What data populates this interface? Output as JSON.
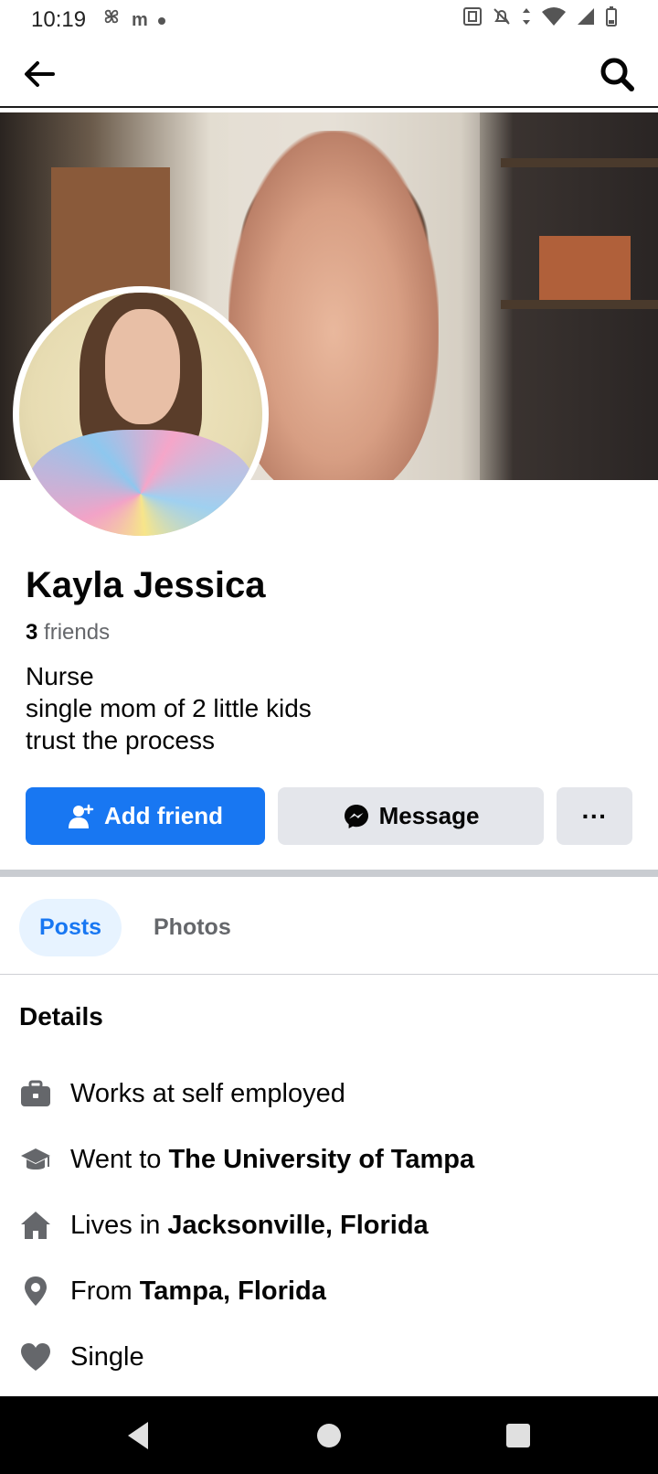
{
  "status_bar": {
    "time": "10:19",
    "left_icons": [
      "pinwheel-icon",
      "m-zone-icon",
      "dot-icon"
    ],
    "right_icons": [
      "nfc-icon",
      "bell-off-icon",
      "data-arrows-icon",
      "wifi-icon",
      "signal-icon",
      "battery-icon"
    ]
  },
  "header": {
    "back_icon": "arrow-left-icon",
    "search_icon": "search-icon"
  },
  "profile": {
    "name": "Kayla Jessica",
    "friends_count": "3",
    "friends_label": "friends",
    "bio": [
      "Nurse",
      "single mom of 2 little kids",
      "trust the process"
    ]
  },
  "actions": {
    "add_friend": "Add friend",
    "message": "Message",
    "more": "···"
  },
  "tabs": [
    {
      "label": "Posts",
      "selected": true
    },
    {
      "label": "Photos",
      "selected": false
    }
  ],
  "details": {
    "title": "Details",
    "items": [
      {
        "icon": "briefcase-icon",
        "prefix": "Works at self employed",
        "bold": ""
      },
      {
        "icon": "graduation-cap-icon",
        "prefix": "Went to ",
        "bold": "The University of Tampa"
      },
      {
        "icon": "home-icon",
        "prefix": "Lives in ",
        "bold": "Jacksonville, Florida"
      },
      {
        "icon": "location-pin-icon",
        "prefix": "From ",
        "bold": "Tampa, Florida"
      },
      {
        "icon": "heart-icon",
        "prefix": "Single",
        "bold": ""
      }
    ]
  },
  "colors": {
    "primary": "#1877f2",
    "secondary_button": "#e4e6eb",
    "tab_selected_bg": "#e7f3ff",
    "muted_text": "#65676b"
  }
}
